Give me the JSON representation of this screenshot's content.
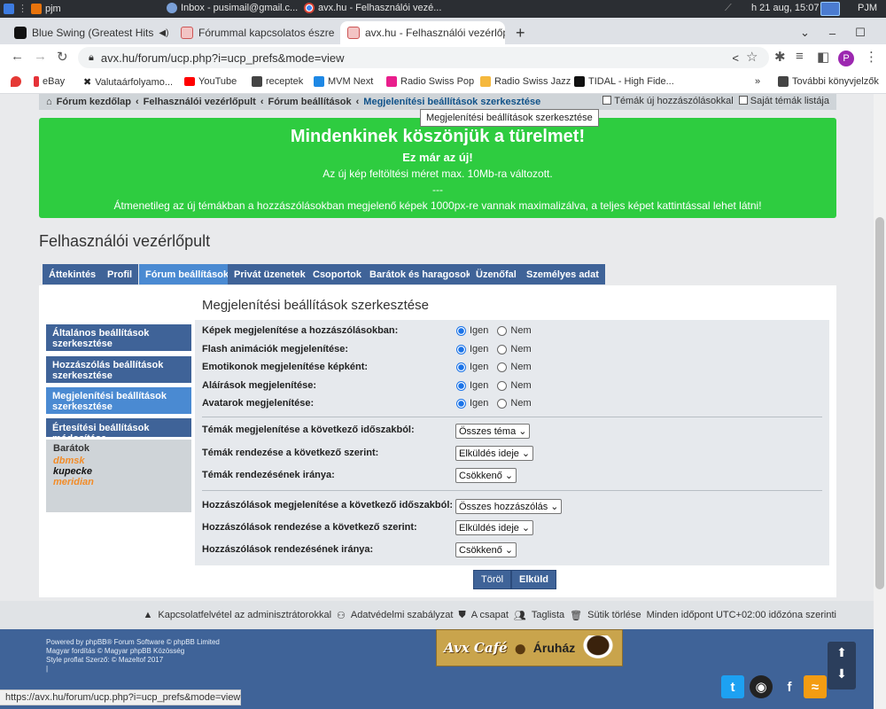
{
  "os": {
    "app": "pjm",
    "window": "Inbox - pusimail@gmail.c...",
    "active_window": "avx.hu - Felhasználói vezé...",
    "datetime": "h 21 aug, 15:07",
    "user": "PJM"
  },
  "tabs": [
    {
      "label": "Blue Swing (Greatest Hits",
      "close": "✕"
    },
    {
      "label": "Fórummal kapcsolatos észre",
      "close": "✕"
    },
    {
      "label": "avx.hu - Felhasználói vezérlőp",
      "close": "✕"
    }
  ],
  "new_tab": "+",
  "url": "avx.hu/forum/ucp.php?i=ucp_prefs&mode=view",
  "profile_initial": "P",
  "bookmarks": [
    "eBay",
    "Valutaárfolyamo...",
    "YouTube",
    "receptek",
    "MVM Next",
    "Radio Swiss Pop",
    "Radio Swiss Jazz",
    "TIDAL - High Fide...",
    "»",
    "További könyvjelzők"
  ],
  "breadcrumb": {
    "home": "Fórum kezdőlap",
    "items": [
      "Felhasználói vezérlőpult",
      "Fórum beállítások",
      "Megjelenítési beállítások szerkesztése"
    ],
    "sep": "‹",
    "right": [
      "Témák új hozzászólásokkal",
      "Saját témák listája"
    ]
  },
  "tooltip": "Megjelenítési beállítások szerkesztése",
  "banner": {
    "title": "Mindenkinek köszönjük a türelmet!",
    "subtitle": "Ez már az új!",
    "line1": "Az új kép feltöltési méret max. 10Mb-ra változott.",
    "line2": "---",
    "line3": "Átmenetileg az új témákban a hozzászólásokban megjelenő képek 1000px-re vannak maximalizálva, a teljes képet kattintással lehet látni!"
  },
  "page_title": "Felhasználói vezérlőpult",
  "nav_tabs": [
    "Áttekintés",
    "Profil",
    "Fórum beállítások",
    "Privát üzenetek",
    "Csoportok",
    "Barátok és haragosok",
    "Üzenőfal",
    "Személyes adat"
  ],
  "sidebar": {
    "items": [
      "Általános beállítások szerkesztése",
      "Hozzászólás beállítások szerkesztése",
      "Megjelenítési beállítások szerkesztése",
      "Értesítési beállítások módosítása"
    ],
    "friends_header": "Barátok",
    "friends": [
      {
        "name": "dbmsk",
        "color": "#f28c28"
      },
      {
        "name": "kupecke",
        "color": "#111111"
      },
      {
        "name": "meridian",
        "color": "#f28c28"
      }
    ]
  },
  "section_title": "Megjelenítési beállítások szerkesztése",
  "yes": "Igen",
  "no": "Nem",
  "radio_settings": [
    "Képek megjelenítése a hozzászólásokban:",
    "Flash animációk megjelenítése:",
    "Emotikonok megjelenítése képként:",
    "Aláírások megjelenítése:",
    "Avatarok megjelenítése:"
  ],
  "select_settings": [
    {
      "label": "Témák megjelenítése a következő időszakból:",
      "value": "Összes téma"
    },
    {
      "label": "Témák rendezése a következő szerint:",
      "value": "Elküldés ideje"
    },
    {
      "label": "Témák rendezésének iránya:",
      "value": "Csökkenő"
    },
    {
      "label": "Hozzászólások megjelenítése a következő időszakból:",
      "value": "Összes hozzászólás"
    },
    {
      "label": "Hozzászólások rendezése a következő szerint:",
      "value": "Elküldés ideje"
    },
    {
      "label": "Hozzászólások rendezésének iránya:",
      "value": "Csökkenő"
    }
  ],
  "buttons": {
    "reset": "Töröl",
    "submit": "Elküld"
  },
  "footer_links": [
    "Kapcsolatfelvétel az adminisztrátorokkal",
    "Adatvédelmi szabályzat",
    "A csapat",
    "Taglista",
    "Sütik törlése",
    "Minden időpont UTC+02:00 időzóna szerinti"
  ],
  "credits": [
    "Powered by phpBB® Forum Software © phpBB Limited",
    "Magyar fordítás © Magyar phpBB Közösség",
    "Style proflat Szerző: © Mazeltof 2017",
    "|"
  ],
  "cafe": {
    "left": "Avx Café",
    "right": "Áruház"
  },
  "social": [
    "t",
    "gh",
    "f",
    "rss"
  ],
  "status_url": "https://avx.hu/forum/ucp.php?i=ucp_prefs&mode=view"
}
